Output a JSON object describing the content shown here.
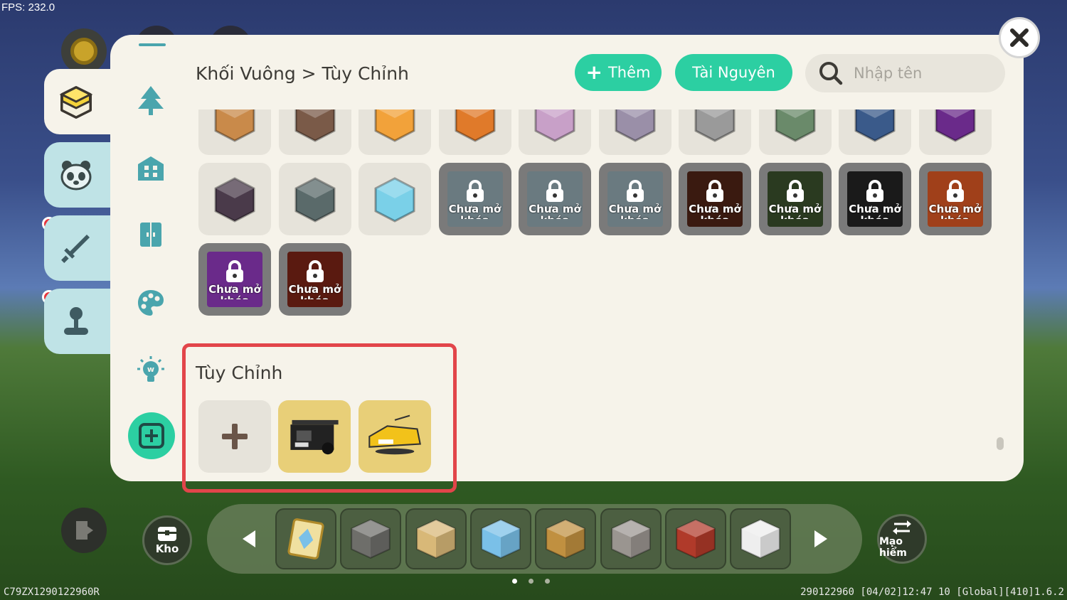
{
  "hud": {
    "fps": "FPS: 232.0"
  },
  "panel": {
    "breadcrumb": "Khối Vuông > Tùy Chỉnh",
    "add_button": "Thêm",
    "resources_button": "Tài Nguyên",
    "search_placeholder": "Nhập tên",
    "locked_label": "Chưa mở khóa",
    "custom_section_title": "Tùy Chỉnh"
  },
  "side_tabs": [
    "block-tab",
    "creature-tab",
    "weapon-tab",
    "joystick-tab"
  ],
  "nav_icons": [
    "tree-icon",
    "building-icon",
    "door-icon",
    "palette-icon",
    "lightbulb-icon",
    "add-category-icon"
  ],
  "grid": {
    "row1": [
      {
        "name": "totem-pink",
        "color": "#c98a4a"
      },
      {
        "name": "totem-brown",
        "color": "#7a5a48"
      },
      {
        "name": "orange-fruit",
        "color": "#f2a23a"
      },
      {
        "name": "flame-sword",
        "color": "#e07a2a"
      },
      {
        "name": "purple-block",
        "color": "#c8a0c8"
      },
      {
        "name": "stone-pedestal",
        "color": "#9a8fa8"
      },
      {
        "name": "stone-statue",
        "color": "#9a9a9a"
      },
      {
        "name": "green-statue",
        "color": "#6a8a6a"
      },
      {
        "name": "blue-dragon",
        "color": "#3a5a8a"
      },
      {
        "name": "dark-dragon",
        "color": "#6a2a8a"
      }
    ],
    "row2": [
      {
        "name": "dark-hammer",
        "color": "#4a3a4a",
        "locked": false
      },
      {
        "name": "stone-machine",
        "color": "#5a6a6a",
        "locked": false
      },
      {
        "name": "crystal-orb",
        "color": "#7ad0e8",
        "locked": false
      },
      {
        "name": "locked-1",
        "color": "#6a7a80",
        "locked": true
      },
      {
        "name": "locked-2",
        "color": "#6a7a80",
        "locked": true
      },
      {
        "name": "locked-3",
        "color": "#6a7a80",
        "locked": true
      },
      {
        "name": "locked-4",
        "color": "#3a1a10",
        "locked": true
      },
      {
        "name": "locked-5",
        "color": "#2a3a20",
        "locked": true
      },
      {
        "name": "locked-6",
        "color": "#1a1a1a",
        "locked": true
      },
      {
        "name": "locked-7",
        "color": "#a0401a",
        "locked": true
      }
    ],
    "row3": [
      {
        "name": "locked-8",
        "color": "#6a2a8a",
        "locked": true
      },
      {
        "name": "locked-9",
        "color": "#5a1a10",
        "locked": true
      }
    ]
  },
  "custom_items": [
    {
      "name": "custom-truck",
      "color": "#e8cf78"
    },
    {
      "name": "custom-car",
      "color": "#e8cf78"
    }
  ],
  "hotbar": {
    "storage_label": "Kho",
    "adventure_label": "Mạo hiểm",
    "slots": [
      {
        "name": "blueprint-item",
        "color": "#f0e0a0"
      },
      {
        "name": "cobblestone-block",
        "color": "#6e6e6a"
      },
      {
        "name": "sand-block",
        "color": "#d8b878"
      },
      {
        "name": "ice-block",
        "color": "#7ac0e8"
      },
      {
        "name": "wood-plank-block",
        "color": "#c09040"
      },
      {
        "name": "stone-brick-block",
        "color": "#9a9590"
      },
      {
        "name": "brick-block",
        "color": "#b03a2a"
      },
      {
        "name": "white-block",
        "color": "#eeeeee"
      }
    ]
  },
  "footer": {
    "left": "C79ZX1290122960R",
    "right": "290122960  [04/02]12:47 10 [Global][410]1.6.2"
  }
}
